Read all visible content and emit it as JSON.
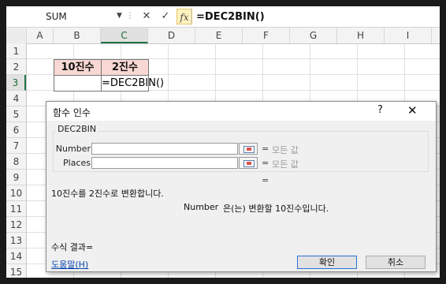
{
  "formula_bar": {
    "name_box": "SUM",
    "cancel_glyph": "✕",
    "enter_glyph": "✓",
    "fx_label": "fx",
    "formula": "=DEC2BIN()"
  },
  "grid": {
    "columns": [
      "A",
      "B",
      "C",
      "D",
      "E",
      "F",
      "G",
      "H",
      "I"
    ],
    "rows": [
      "1",
      "2",
      "3",
      "4",
      "5",
      "6",
      "7",
      "8",
      "9",
      "10",
      "11",
      "12",
      "13",
      "14",
      "15"
    ],
    "cells": {
      "B2": "10진수",
      "C2": "2진수",
      "C3": "=DEC2BIN()"
    },
    "header_fill": "#f8d8d2",
    "selection_color": "#217346"
  },
  "dialog": {
    "title": "함수 인수",
    "help_button": "?",
    "close_button": "✕",
    "function_name": "DEC2BIN",
    "args": [
      {
        "label": "Number",
        "value": "",
        "equals": "=",
        "result": "모든 값"
      },
      {
        "label": "Places",
        "value": "",
        "equals": "=",
        "result": "모든 값"
      }
    ],
    "function_result_equals": "=",
    "description": "10진수를 2진수로 변환합니다.",
    "arg_desc_name": "Number",
    "arg_desc_text": "은(는) 변환할 10진수입니다.",
    "formula_result": "수식 결과=",
    "help_link": "도움말(H)",
    "ok_button": "확인",
    "cancel_button": "취소"
  }
}
